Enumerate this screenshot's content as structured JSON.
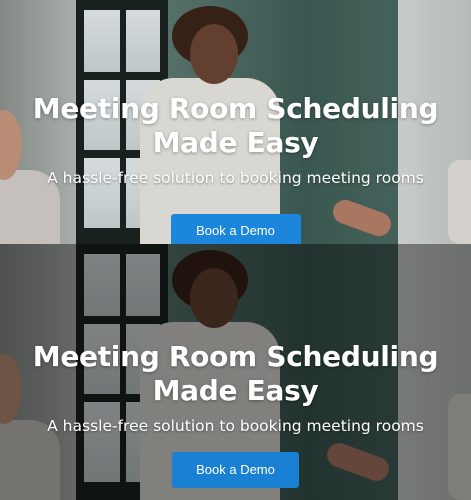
{
  "hero_top": {
    "headline_line1": "Meeting Room Scheduling",
    "headline_line2": "Made Easy",
    "subheadline": "A hassle-free solution to booking meeting rooms",
    "cta_label": "Book a Demo"
  },
  "hero_bottom": {
    "headline_line1": "Meeting Room Scheduling",
    "headline_line2": "Made Easy",
    "subheadline": "A hassle-free solution to booking meeting rooms",
    "cta_label": "Book a Demo"
  },
  "colors": {
    "cta_background": "#1c86dd",
    "text": "#ffffff",
    "overlay_dark": "rgba(0,0,0,0.45)"
  }
}
